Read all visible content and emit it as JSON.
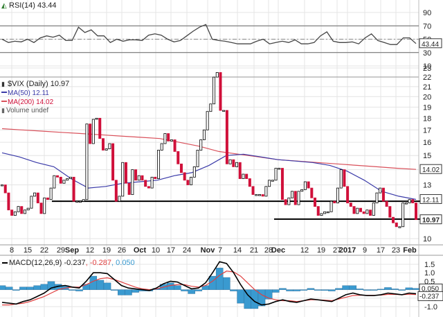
{
  "chart_data": [
    {
      "type": "line",
      "panel": "rsi",
      "legend": "RSI(14) 43.44",
      "value_box": "43.44",
      "y_ticks": [
        "90",
        "70",
        "50",
        "30",
        "10"
      ],
      "ylim": [
        0,
        100
      ],
      "reference_lines": [
        70,
        50,
        30
      ],
      "values": [
        50,
        45,
        47,
        46,
        50,
        45,
        52,
        55,
        53,
        56,
        48,
        48,
        68,
        60,
        64,
        55,
        55,
        45,
        50,
        47,
        49,
        49,
        48,
        56,
        58,
        56,
        50,
        46,
        48,
        55,
        62,
        68,
        72,
        50,
        48,
        47,
        45,
        43,
        43,
        43,
        47,
        50,
        43,
        45,
        47,
        45,
        49,
        43,
        43,
        45,
        55,
        61,
        47,
        45,
        45,
        46,
        43,
        52,
        58,
        48,
        45,
        42,
        42,
        52,
        52,
        43.44
      ],
      "color": "#444444"
    },
    {
      "type": "candlestick",
      "panel": "price",
      "legend": {
        "title": "$VIX (Daily) 10.97",
        "ma50": "MA(50) 12.11",
        "ma200": "MA(200) 14.02",
        "volume": "Volume undef"
      },
      "y_scale": "log",
      "ylim": [
        10,
        23
      ],
      "y_ticks": [
        "23",
        "22",
        "21",
        "20",
        "19",
        "18",
        "17",
        "16",
        "15",
        "13",
        "10"
      ],
      "value_boxes": {
        "ma200": "14.02",
        "ma50": "12.11",
        "close": "10.97"
      },
      "x_ticks": [
        {
          "label": "8",
          "bold": false
        },
        {
          "label": "15",
          "bold": false
        },
        {
          "label": "22",
          "bold": false
        },
        {
          "label": "29",
          "bold": false
        },
        {
          "label": "Sep",
          "bold": true
        },
        {
          "label": "12",
          "bold": false
        },
        {
          "label": "19",
          "bold": false
        },
        {
          "label": "26",
          "bold": false
        },
        {
          "label": "Oct",
          "bold": true
        },
        {
          "label": "10",
          "bold": false
        },
        {
          "label": "17",
          "bold": false
        },
        {
          "label": "24",
          "bold": false
        },
        {
          "label": "Nov",
          "bold": true
        },
        {
          "label": "7",
          "bold": false
        },
        {
          "label": "14",
          "bold": false
        },
        {
          "label": "21",
          "bold": false
        },
        {
          "label": "28",
          "bold": false
        },
        {
          "label": "Dec",
          "bold": true
        },
        {
          "label": "12",
          "bold": false
        },
        {
          "label": "19",
          "bold": false
        },
        {
          "label": "27",
          "bold": false
        },
        {
          "label": "2017",
          "bold": true
        },
        {
          "label": "9",
          "bold": false
        },
        {
          "label": "17",
          "bold": false
        },
        {
          "label": "23",
          "bold": false
        },
        {
          "label": "Feb",
          "bold": true
        }
      ],
      "closes": [
        13,
        12.5,
        11.5,
        11.2,
        11.4,
        11.7,
        11.3,
        11.5,
        11.6,
        12.3,
        12.5,
        11.9,
        11.3,
        12.2,
        12.1,
        12.8,
        13.6,
        13.5,
        13.1,
        13.3,
        13.4,
        13.5,
        12.0,
        12.0,
        12.0,
        12.1,
        17.5,
        15.9,
        17.9,
        18.0,
        16.3,
        15.4,
        15.5,
        15.9,
        13.3,
        12.0,
        12.3,
        14.5,
        13.1,
        12.4,
        14.0,
        13.3,
        13.6,
        13.3,
        12.9,
        12.8,
        13.5,
        13.4,
        15.4,
        15.9,
        16.7,
        16.1,
        16.2,
        15.3,
        14.4,
        13.8,
        13.3,
        13.0,
        13.5,
        14.2,
        15.4,
        16.2,
        17.0,
        18.6,
        19.3,
        22.0,
        22.5,
        18.7,
        18.7,
        14.4,
        14.7,
        14.2,
        14.5,
        13.4,
        13.7,
        13.4,
        12.9,
        12.4,
        12.4,
        12.4,
        12.3,
        12.9,
        13.3,
        13.3,
        14.1,
        14.1,
        12.1,
        11.8,
        12.2,
        12.6,
        11.8,
        12.6,
        12.7,
        13.2,
        12.8,
        12.2,
        11.7,
        11.2,
        11.3,
        11.4,
        11.4,
        12.0,
        11.9,
        12.8,
        14.0,
        12.9,
        11.9,
        11.7,
        11.3,
        11.6,
        11.4,
        11.3,
        11.5,
        11.2,
        11.9,
        12.5,
        12.8,
        12.0,
        11.7,
        11.1,
        10.8,
        10.6,
        10.6,
        11.9,
        11.9,
        12.1,
        11.9,
        10.97
      ],
      "ma50": [
        15.2,
        14.9,
        14.5,
        14.2,
        13.4,
        12.8,
        12.9,
        13.1,
        13.2,
        13.3,
        13.6,
        13.8,
        14.3,
        15.0,
        15.1,
        14.9,
        14.7,
        14.6,
        14.5,
        14.3,
        13.9,
        13.3,
        12.6,
        12.3,
        12.11
      ],
      "ma200": [
        17.1,
        17.0,
        16.9,
        16.8,
        16.7,
        16.6,
        16.5,
        16.4,
        16.3,
        16.0,
        15.7,
        15.3,
        15.1,
        14.9,
        14.7,
        14.6,
        14.5,
        14.4,
        14.3,
        14.2,
        14.1,
        14.02
      ],
      "support_levels": [
        12.0,
        11.0
      ],
      "colors": {
        "up": "#000000",
        "down": "#d0103a",
        "ma50": "#3a3aa8",
        "ma200": "#d9505a"
      }
    },
    {
      "type": "line",
      "panel": "macd",
      "legend": {
        "label": "MACD(12,26,9)",
        "macd": "-0.237",
        "signal": "-0.287",
        "histogram": "0.050"
      },
      "value_boxes": {
        "histogram": "0.050",
        "macd": "-0.237"
      },
      "y_ticks": [
        "1.5",
        "1.0",
        "0.5",
        "-0.5",
        "-1.0"
      ],
      "ylim": [
        -1.1,
        1.8
      ],
      "macd": [
        -0.75,
        -0.8,
        -0.85,
        -0.7,
        -0.6,
        -0.4,
        -0.2,
        0.1,
        0.2,
        0.25,
        0.15,
        0.1,
        0.5,
        1.0,
        1.0,
        0.95,
        0.6,
        0.25,
        0.1,
        0.05,
        0.0,
        -0.05,
        0.1,
        0.35,
        0.5,
        0.45,
        0.25,
        0.05,
        0.1,
        0.4,
        1.0,
        1.65,
        1.55,
        1.0,
        0.3,
        -0.3,
        -0.7,
        -0.9,
        -0.85,
        -0.7,
        -0.6,
        -0.7,
        -0.75,
        -0.65,
        -0.55,
        -0.6,
        -0.65,
        -0.7,
        -0.5,
        -0.3,
        -0.2,
        -0.3,
        -0.35,
        -0.35,
        -0.3,
        -0.2,
        -0.25,
        -0.3,
        -0.2,
        -0.237
      ],
      "signal": [
        -0.9,
        -0.9,
        -0.85,
        -0.8,
        -0.7,
        -0.55,
        -0.4,
        -0.2,
        0,
        0.1,
        0.15,
        0.15,
        0.3,
        0.5,
        0.65,
        0.7,
        0.6,
        0.45,
        0.3,
        0.15,
        0.05,
        0,
        0.05,
        0.15,
        0.25,
        0.3,
        0.3,
        0.2,
        0.15,
        0.25,
        0.5,
        0.85,
        1.1,
        1.05,
        0.8,
        0.4,
        0,
        -0.3,
        -0.5,
        -0.6,
        -0.65,
        -0.65,
        -0.7,
        -0.65,
        -0.6,
        -0.6,
        -0.62,
        -0.65,
        -0.55,
        -0.45,
        -0.35,
        -0.33,
        -0.33,
        -0.33,
        -0.32,
        -0.28,
        -0.28,
        -0.3,
        -0.27,
        -0.287
      ],
      "colors": {
        "macd": "#000000",
        "signal": "#e04040",
        "histogram": "#3a9ad0"
      }
    }
  ]
}
